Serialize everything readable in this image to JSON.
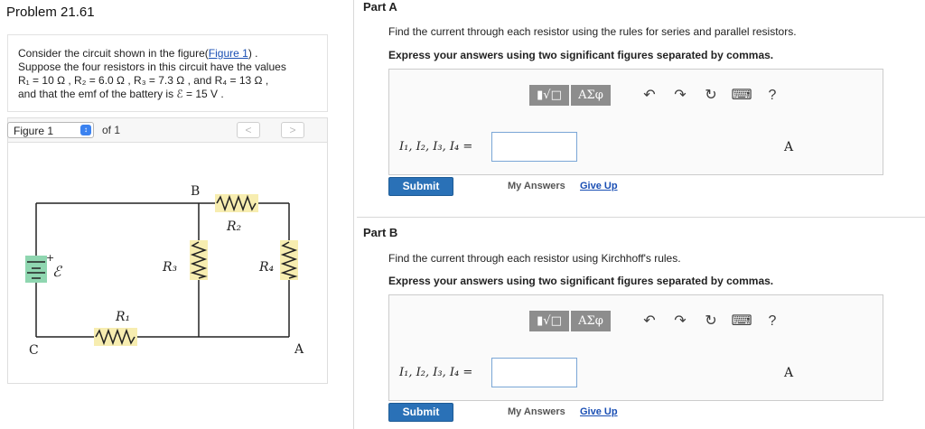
{
  "problem": {
    "title": "Problem 21.61",
    "intro_line1_prefix": "Consider the circuit shown in the figure(",
    "figure_link": "Figure 1",
    "intro_line1_suffix": ") .",
    "intro_line2": "Suppose the four resistors in this circuit have the values",
    "intro_line3": "R₁ = 10 Ω , R₂ = 6.0 Ω , R₃ = 7.3 Ω , and R₄ = 13 Ω ,",
    "intro_line4": "and that the emf of the battery is ℰ = 15 V ."
  },
  "figure": {
    "selected": "Figure 1",
    "of_label": "of 1",
    "prev_icon": "<",
    "next_icon": ">",
    "labels": {
      "B": "B",
      "C": "C",
      "A": "A",
      "R1": "R₁",
      "R2": "R₂",
      "R3": "R₃",
      "R4": "R₄",
      "emf": "ℰ",
      "plus": "+"
    }
  },
  "partA": {
    "label": "Part A",
    "instruction": "Find the current through each resistor using the rules for series and parallel resistors.",
    "format": "Express your answers using two significant figures separated by commas.",
    "equation_label": "I₁, I₂, I₃, I₄ =",
    "unit": "A",
    "submit": "Submit",
    "my_answers": "My Answers",
    "give_up": "Give Up"
  },
  "partB": {
    "label": "Part B",
    "instruction": "Find the current through each resistor using Kirchhoff's rules.",
    "format": "Express your answers using two significant figures separated by commas.",
    "equation_label": "I₁, I₂, I₃, I₄ =",
    "unit": "A",
    "submit": "Submit",
    "my_answers": "My Answers",
    "give_up": "Give Up"
  },
  "toolbar": {
    "template_icon": "▮√□",
    "symbols_label": "ΑΣφ",
    "help": "?",
    "icons": [
      "templates-icon",
      "greek-symbols-icon",
      "undo-icon",
      "redo-icon",
      "reset-icon",
      "keyboard-icon",
      "help-icon"
    ]
  },
  "colors": {
    "submit_bg": "#2a71b7",
    "link": "#1a4fb4",
    "resistor_highlight": "#f7edb0",
    "battery_highlight": "#8fd6b0",
    "toolbar_button": "#8d8d8d"
  }
}
